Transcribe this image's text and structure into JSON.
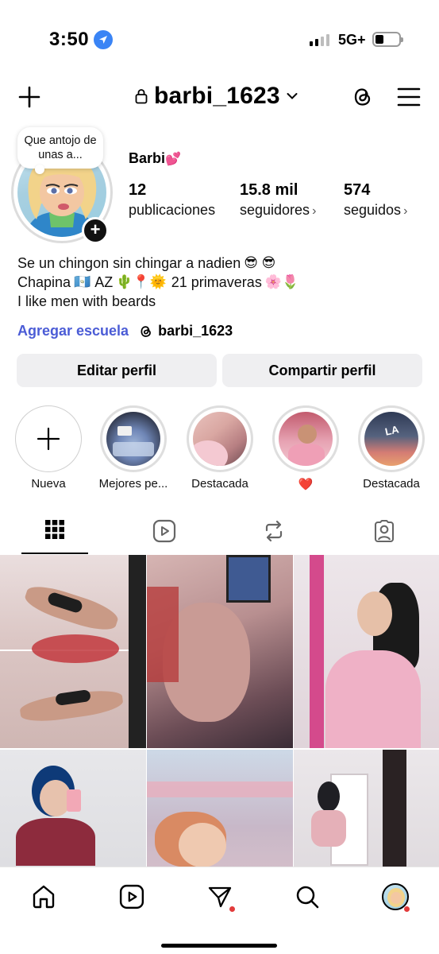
{
  "status_bar": {
    "time": "3:50",
    "network": "5G+",
    "signal_bars_active": 2,
    "signal_bars_total": 4,
    "battery_level": 0.35
  },
  "header": {
    "username": "barbi_1623",
    "icons": [
      "plus-icon",
      "lock-icon",
      "chevron-down-icon",
      "threads-icon",
      "menu-icon"
    ]
  },
  "profile": {
    "note": "Que antojo de unas a...",
    "display_name": "Barbi",
    "display_name_emoji": "💕",
    "stats": [
      {
        "value": "12",
        "label": "publicaciones"
      },
      {
        "value": "15.8 mil",
        "label": "seguidores"
      },
      {
        "value": "574",
        "label": "seguidos"
      }
    ],
    "bio": {
      "line1": "Se un chingon sin chingar a nadien",
      "line1_emoji": "😎 😎",
      "line2_a": "Chapina",
      "line2_flag": "🇬🇹",
      "line2_b": "AZ",
      "line2_emoji_a": "🌵📍🌞",
      "line2_c": "21 primaveras",
      "line2_emoji_b": "🌸🌷",
      "line3": "I like men with beards"
    },
    "add_school": "Agregar escuela",
    "threads_handle": "barbi_1623"
  },
  "buttons": {
    "edit": "Editar perfil",
    "share": "Compartir perfil"
  },
  "highlights": [
    {
      "label": "Nueva"
    },
    {
      "label": "Mejores pe..."
    },
    {
      "label": "Destacada"
    },
    {
      "label": "❤️"
    },
    {
      "label": "Destacada"
    }
  ],
  "highlight_overlay_text": "LA",
  "tabs": [
    "grid-icon",
    "reels-icon",
    "reposts-icon",
    "tagged-icon"
  ],
  "active_tab": 0,
  "bottom_nav": [
    "home-icon",
    "reels-icon",
    "messages-icon",
    "search-icon",
    "profile-avatar"
  ],
  "colors": {
    "link_blue": "#4b5cd6",
    "button_bg": "#efeff1",
    "notification_red": "#e23b3b",
    "location_blue": "#3a84f5"
  }
}
